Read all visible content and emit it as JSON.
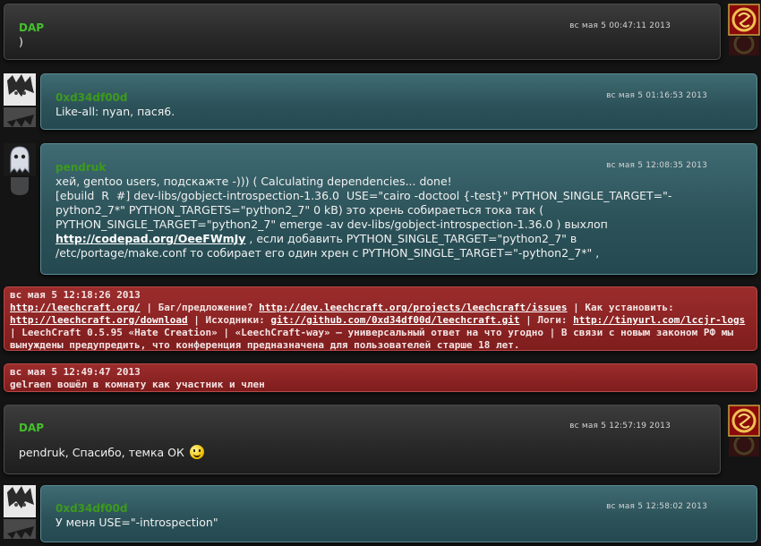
{
  "colors": {
    "self_nick": "#44c02c",
    "other_nick": "#3c9a1c",
    "system_bg": "#8f2525",
    "other_bg": "#2d535a",
    "self_bg": "#2e2e2e"
  },
  "messages": [
    {
      "nick": "DAP",
      "time": "вс мая 5 00:47:11 2013",
      "text": ")"
    },
    {
      "nick": "0xd34df00d",
      "time": "вс мая 5 01:16:53 2013",
      "text": "Like-all: nyan, пася6."
    },
    {
      "nick": "pendruk",
      "time": "вс мая 5 12:08:35 2013",
      "text_a": "хей, gentoo users, подскажте -))) ( Calculating dependencies... done!\n[ebuild  R  #] dev-libs/gobject-introspection-1.36.0  USE=\"cairo -doctool {-test}\" PYTHON_SINGLE_TARGET=\"-python2_7*\" PYTHON_TARGETS=\"python2_7\" 0 kB) это хрень собираеться тока так ( PYTHON_SINGLE_TARGET=\"python2_7\" emerge -av dev-libs/gobject-introspection-1.36.0 ) выхлоп ",
      "link": "http://codepad.org/OeeFWmJy",
      "text_b": " , если добавить PYTHON_SINGLE_TARGET=\"python2_7\" в /etc/portage/make.conf то собирает его один хрен с PYTHON_SINGLE_TARGET=\"-python2_7*\" ,"
    },
    {
      "nick": "DAP",
      "time": "вс мая 5 12:57:19 2013",
      "text": "pendruk, Спасибо, темка ОК"
    },
    {
      "nick": "0xd34df00d",
      "time": "вс мая 5 12:58:02 2013",
      "text": "У меня USE=\"-introspection\""
    }
  ],
  "system1": {
    "time": "вс мая 5 12:18:26 2013",
    "link1": "http://leechcraft.org/",
    "t1": " | Баг/предложение? ",
    "link2": "http://dev.leechcraft.org/projects/leechcraft/issues",
    "t2": " | Как установить: ",
    "link3": "http://leechcraft.org/download",
    "t3": " | Исходники: ",
    "link4": "git://github.com/0xd34df00d/leechcraft.git",
    "t4": " | Логи: ",
    "link5": "http://tinyurl.com/lccjr-logs",
    "t5": " | LeechCraft 0.5.95 «Hate Creation» | «LeechCraft-way» — универсальный ответ на что угодно | В связи с новым законом РФ мы вынуждены предупредить, что конференция предназначена для пользователей старше 18 лет."
  },
  "system2": {
    "time": "вс мая 5 12:49:47 2013",
    "text": "gelraen вошёл в комнату как участник и член"
  },
  "icons": {
    "self_avatar": "dragon-emblem-icon",
    "pendruk_avatar": "ghost-icon",
    "0xd34df00d_avatar": "anime-avatar-icon",
    "smiley": "smiley-icon"
  }
}
